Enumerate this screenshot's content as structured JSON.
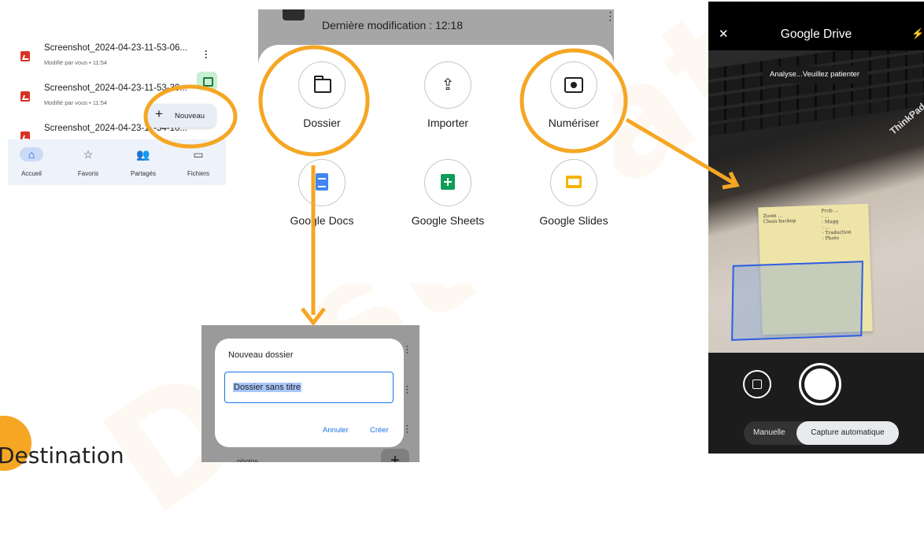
{
  "watermark": "Destination",
  "file_list": {
    "files": [
      {
        "name": "Screenshot_2024-04-23-11-53-06...",
        "meta": "Modifié par vous • 11:54"
      },
      {
        "name": "Screenshot_2024-04-23-11-53-39...",
        "meta": "Modifié par vous • 11:54"
      },
      {
        "name": "Screenshot_2024-04-23-11-54-10...",
        "meta": ""
      }
    ],
    "new_button": "Nouveau",
    "nav": [
      {
        "label": "Accueil",
        "icon": "home-icon",
        "glyph": "⌂",
        "active": true
      },
      {
        "label": "Favoris",
        "icon": "star-icon",
        "glyph": "☆",
        "active": false
      },
      {
        "label": "Partagés",
        "icon": "people-icon",
        "glyph": "👥",
        "active": false
      },
      {
        "label": "Fichiers",
        "icon": "folder-icon",
        "glyph": "▭",
        "active": false
      }
    ]
  },
  "create_menu": {
    "header_title": "Dernière modification : 12:18",
    "items": {
      "folder": "Dossier",
      "upload": "Importer",
      "scan": "Numériser",
      "docs": "Google Docs",
      "sheets": "Google Sheets",
      "slides": "Google Slides"
    }
  },
  "new_folder_dialog": {
    "title": "Nouveau dossier",
    "input_value": "Dossier sans titre",
    "cancel": "Annuler",
    "create": "Créer",
    "below_text": "photos"
  },
  "camera": {
    "title": "Google Drive",
    "status_chip": "Analyse...Veuillez patienter",
    "brand_text": "ThinkPad",
    "note_left": "Zoom ...\nClean backup",
    "note_right": "Prob ...\n- ...\n- Magg\n- ...\n- Traduction\n- Photo",
    "mode_manual": "Manuelle",
    "mode_auto": "Capture automatique"
  },
  "accent_color": "#f5a623",
  "link_color": "#1a73e8"
}
